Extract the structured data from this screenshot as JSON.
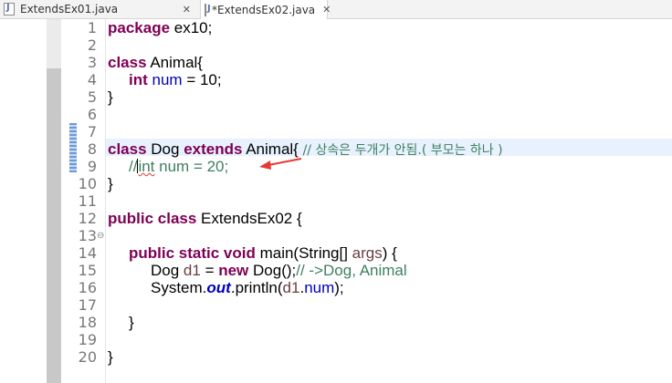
{
  "tabs": [
    {
      "label": "ExtendsEx01.java",
      "active": false
    },
    {
      "label": "*ExtendsEx02.java",
      "active": true
    }
  ],
  "close_glyph": "✕",
  "lines": {
    "n1": "1",
    "n2": "2",
    "n3": "3",
    "n4": "4",
    "n5": "5",
    "n6": "6",
    "n7": "7",
    "n8": "8",
    "n9": "9",
    "n10": "10",
    "n11": "11",
    "n12": "12",
    "n13": "13",
    "n14": "14",
    "n15": "15",
    "n16": "16",
    "n17": "17",
    "n18": "18",
    "n19": "19",
    "n20": "20"
  },
  "code": {
    "l1_kw": "package",
    "l1_rest": " ex10;",
    "l3_kw": "class",
    "l3_rest": " Animal{",
    "l4_kw": "int",
    "l4_field": "num",
    "l4_rest": " = 10;",
    "l5": "}",
    "l7_kw": "class",
    "l7_mid": " Dog ",
    "l7_kw2": "extends",
    "l7_rest": " Animal{ ",
    "l7_comment": "// 상속은 두개가 안됨.( 부모는 하나 )",
    "l8_c1": "//",
    "l8_c2": "int",
    "l8_c3": " num = 20;",
    "l9": "}",
    "l11_kw": "public class",
    "l11_rest": " ExtendsEx02 {",
    "l13_kw": "public static void",
    "l13_rest": " main(String[] ",
    "l13_arg": "args",
    "l13_end": ") {",
    "l14_a": "Dog ",
    "l14_var": "d1",
    "l14_b": " = ",
    "l14_kw": "new",
    "l14_c": " Dog();",
    "l14_comment": "// ->Dog, Animal",
    "l15_a": "System.",
    "l15_out": "out",
    "l15_b": ".println(",
    "l15_var": "d1",
    "l15_c": ".",
    "l15_field": "num",
    "l15_d": ");",
    "l17": "}",
    "l19": "}"
  },
  "colors": {
    "keyword": "#7f0055",
    "field": "#0000c0",
    "comment": "#3f7f5f",
    "arrow": "#e53935"
  },
  "icons": {
    "fold": "collapse-minus-icon",
    "arrow": "red-arrow-annotation"
  }
}
